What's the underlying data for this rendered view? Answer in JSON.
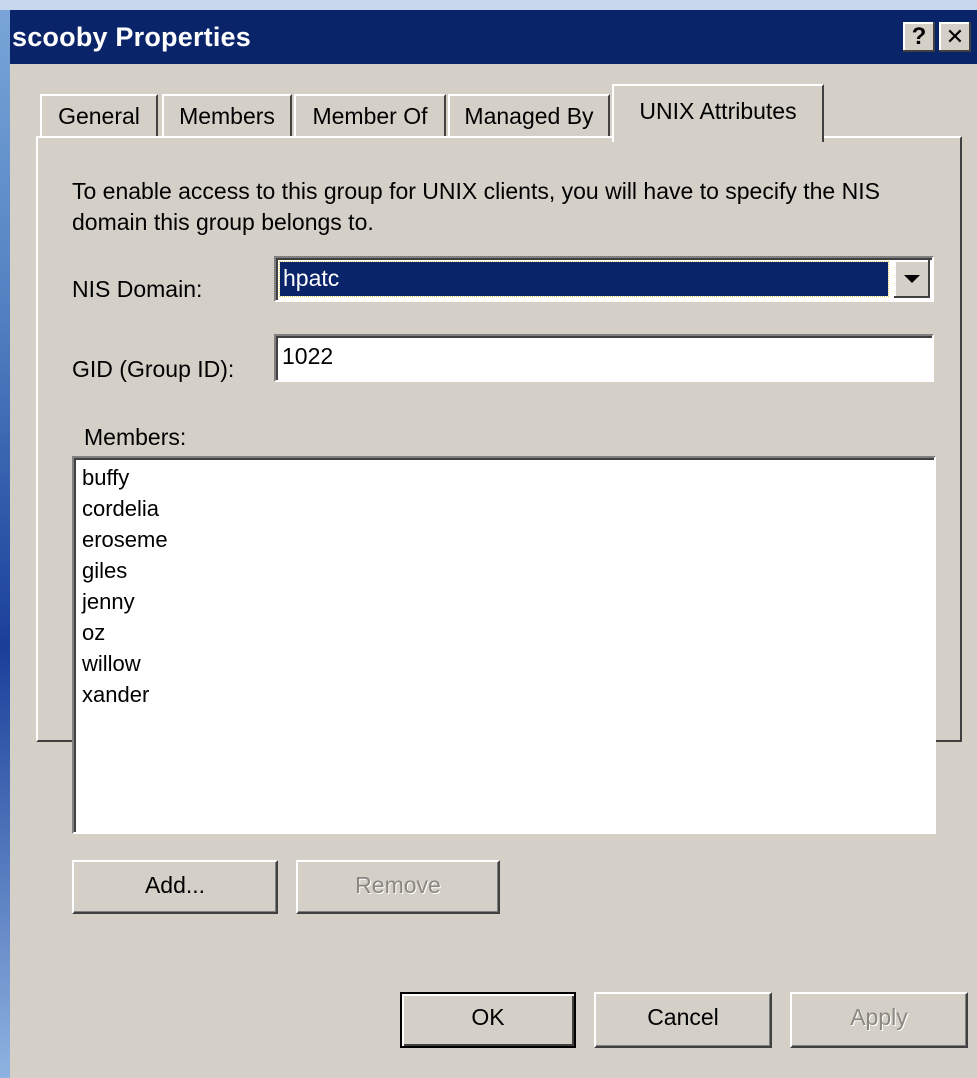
{
  "window": {
    "title": "scooby Properties",
    "help_button": "?",
    "close_button": "✕"
  },
  "tabs": [
    {
      "label": "General",
      "active": false
    },
    {
      "label": "Members",
      "active": false
    },
    {
      "label": "Member Of",
      "active": false
    },
    {
      "label": "Managed By",
      "active": false
    },
    {
      "label": "UNIX Attributes",
      "active": true
    }
  ],
  "panel": {
    "description": "To enable access to this group for UNIX clients, you will have to specify the NIS domain this group belongs to.",
    "nis_domain_label": "NIS Domain:",
    "nis_domain_value": "hpatc",
    "gid_label": "GID (Group ID):",
    "gid_value": "1022",
    "members_label": "Members:",
    "members": [
      "buffy",
      "cordelia",
      "eroseme",
      "giles",
      "jenny",
      "oz",
      "willow",
      "xander"
    ],
    "add_label": "Add...",
    "remove_label": "Remove"
  },
  "footer": {
    "ok_label": "OK",
    "cancel_label": "Cancel",
    "apply_label": "Apply"
  },
  "colors": {
    "titlebar": "#0a246a",
    "face": "#d4d0c8",
    "selection": "#0a246a"
  }
}
